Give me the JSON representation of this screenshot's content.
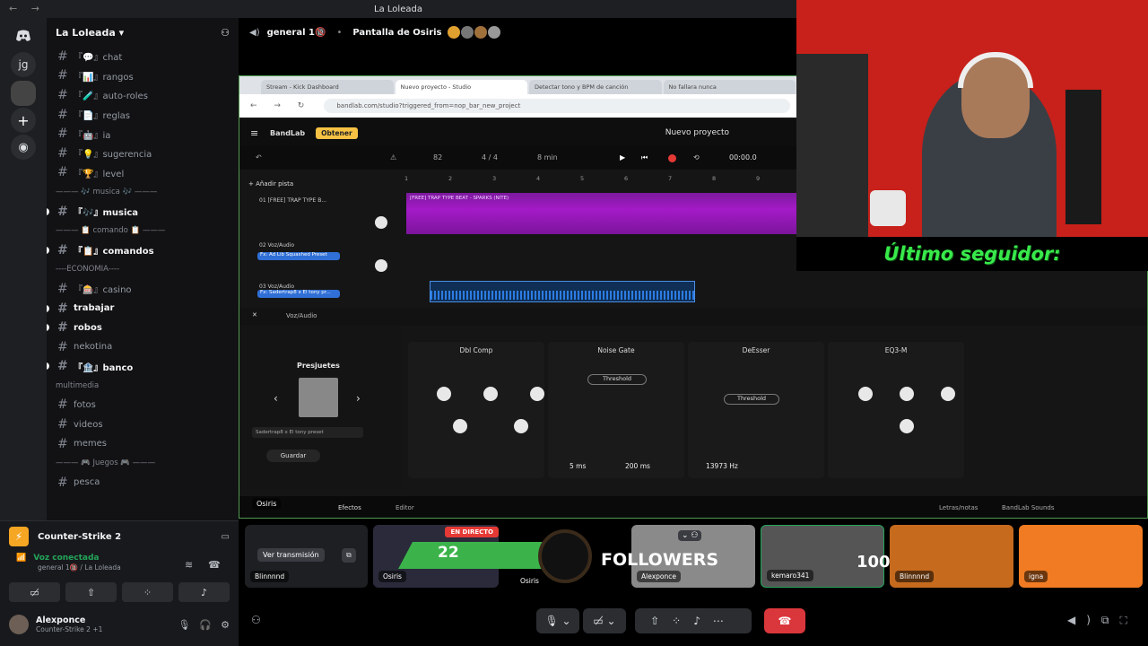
{
  "window": {
    "title": "La Loleada"
  },
  "rail": {
    "dm_icon": "discord-icon",
    "servers": [
      "jg"
    ]
  },
  "server": {
    "name": "La Loleada"
  },
  "channels": [
    {
      "label": "『💬』chat",
      "bold": false
    },
    {
      "label": "『📊』rangos",
      "bold": false
    },
    {
      "label": "『🧪』auto-roles",
      "bold": false
    },
    {
      "label": "『📄』reglas",
      "bold": false
    },
    {
      "label": "『🤖』ia",
      "bold": false
    },
    {
      "label": "『💡』sugerencia",
      "bold": false
    },
    {
      "label": "『🏆』level",
      "bold": false
    }
  ],
  "categories": {
    "musica": "——— 🎶 musica 🎶 ———",
    "comando": "——— 📋 comando 📋 ———",
    "economia": "----ECONOMIA----",
    "multimedia": "multimedia",
    "juegos": "——— 🎮 Juegos 🎮 ———"
  },
  "channels_musica": [
    {
      "label": "『🎶』musica",
      "bold": true
    }
  ],
  "channels_comando": [
    {
      "label": "『📋』comandos",
      "bold": true
    }
  ],
  "channels_economia": [
    {
      "label": "『🎰』casino",
      "bold": false
    },
    {
      "label": "trabajar",
      "bold": true
    },
    {
      "label": "robos",
      "bold": true
    },
    {
      "label": "nekotina",
      "bold": false
    },
    {
      "label": "『🏦』banco",
      "bold": true
    }
  ],
  "channels_multimedia": [
    {
      "label": "fotos",
      "bold": false
    },
    {
      "label": "videos",
      "bold": false
    },
    {
      "label": "memes",
      "bold": false
    }
  ],
  "channels_juegos": [
    {
      "label": "pesca",
      "bold": false
    }
  ],
  "activity": {
    "game": "Counter-Strike 2"
  },
  "voice": {
    "status": "Voz conectada",
    "location": "general 1🔞 / La Loleada"
  },
  "user": {
    "name": "Alexponce",
    "status": "Counter-Strike 2 +1"
  },
  "stream": {
    "channel": "general 1🔞",
    "title": "Pantalla de Osiris"
  },
  "browser": {
    "tabs": [
      "Stream - Kick Dashboard",
      "Nuevo proyecto - Studio",
      "Detectar tono y BPM de canción",
      "No fallara nunca"
    ],
    "url": "bandlab.com/studio?triggered_from=nop_bar_new_project"
  },
  "bandlab": {
    "logo": "BandLab",
    "obtain": "Obtener",
    "project": "Nuevo proyecto",
    "bpm": "82",
    "signature": "4 / 4",
    "key": "8 min",
    "time": "00:00.0",
    "add_track": "Añadir pista",
    "ruler": [
      "1",
      "2",
      "3",
      "4",
      "5",
      "6",
      "7",
      "8",
      "9"
    ],
    "tracks": [
      {
        "name": "01 [FREE] TRAP TYPE B...",
        "preset": ""
      },
      {
        "name": "02 Voz/Audio",
        "preset": "Fx: Ad Lib Squashed Preset"
      },
      {
        "name": "03 Voz/Audio",
        "preset": "Fx: Sadertrap8 x El tony pr..."
      }
    ],
    "clip1_label": "[FREE] TRAP TYPE BEAT - SPARKS (NITE)",
    "fx_track": "Voz/Audio",
    "presets_title": "Presjuetes",
    "preset_select": "Sadertrap8 x El tony preset",
    "save": "Guardar",
    "fx_cards": [
      "Dbl Comp",
      "Noise Gate",
      "DeEsser",
      "EQ3-M"
    ],
    "attack": "5 ms",
    "release": "200 ms",
    "frequency": "13973 Hz",
    "threshold": "Threshold",
    "tabs": [
      "Efectos",
      "Editor"
    ],
    "bottom_right": [
      "Letras/notas",
      "BandLab Sounds"
    ]
  },
  "overlay": {
    "last_follower": "Último seguidor:",
    "followers_count": "22",
    "followers_label": "FOLLOWERS",
    "count_100": "100",
    "en_directo": "EN DIRECTO"
  },
  "participants": [
    {
      "name": "Blinnnnd",
      "action": "Ver transmisión"
    },
    {
      "name": "Osiris"
    },
    {
      "name": "Alexponce"
    },
    {
      "name": "kemaro341"
    },
    {
      "name": "Blinnnnd"
    },
    {
      "name": "igna"
    }
  ],
  "share_owner": "Osiris",
  "colors": {
    "accent_green": "#23a55a",
    "follower_green": "#38e94a",
    "hangup_red": "#da373c",
    "clip_purple": "#a41ac7",
    "clip_blue": "#2c7ce2"
  }
}
